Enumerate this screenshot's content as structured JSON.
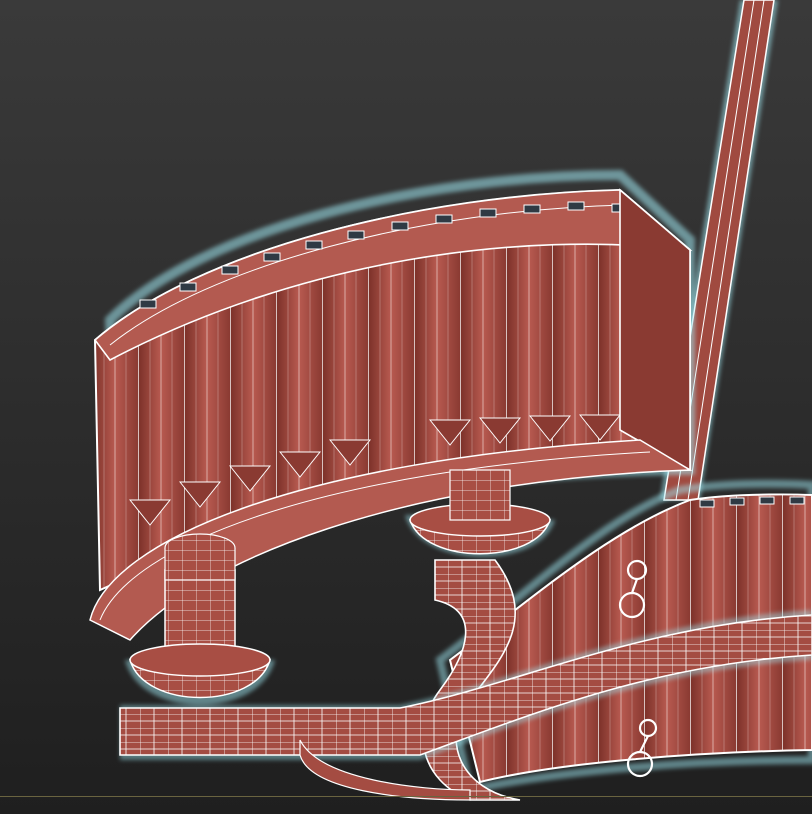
{
  "viewport": {
    "name": "3d-viewport-perspective",
    "render_mode": "shaded-with-wireframe-edges",
    "selection_highlight": "selected"
  },
  "colors": {
    "background_top": "#3a3a3a",
    "background_bottom": "#1f1f1f",
    "mesh_face": "#a04a40",
    "mesh_face_light": "#c06058",
    "mesh_face_dark": "#7a3028",
    "wire": "#ffffff",
    "selection_glow": "#9fe6f0",
    "ground_grid": "#6a6440"
  },
  "objects": [
    {
      "name": "chandelier-upper-crystal-ring"
    },
    {
      "name": "chandelier-lower-crystal-ring"
    },
    {
      "name": "chandelier-spiral-arm"
    },
    {
      "name": "chandelier-suspension-rod"
    },
    {
      "name": "chandelier-bowl-left"
    },
    {
      "name": "chandelier-bowl-center"
    },
    {
      "name": "chandelier-hook-ornament"
    }
  ]
}
